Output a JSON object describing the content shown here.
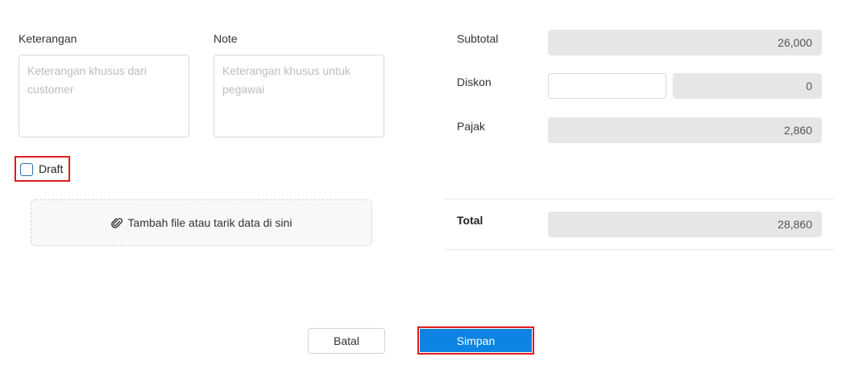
{
  "notes": {
    "keterangan_label": "Keterangan",
    "keterangan_placeholder": "Keterangan khusus dari customer",
    "note_label": "Note",
    "note_placeholder": "Keterangan khusus untuk pegawai"
  },
  "draft": {
    "label": "Draft",
    "checked": false
  },
  "upload": {
    "label": "Tambah file atau tarik data di sini",
    "icon": "paperclip-icon"
  },
  "summary": {
    "subtotal_label": "Subtotal",
    "subtotal_value": "26,000",
    "diskon_label": "Diskon",
    "diskon_input": "",
    "diskon_value": "0",
    "pajak_label": "Pajak",
    "pajak_value": "2,860",
    "total_label": "Total",
    "total_value": "28,860"
  },
  "actions": {
    "cancel_label": "Batal",
    "save_label": "Simpan"
  },
  "colors": {
    "primary": "#0b84e3",
    "highlight": "#e01b1b",
    "readonly_bg": "#e6e6e6"
  }
}
